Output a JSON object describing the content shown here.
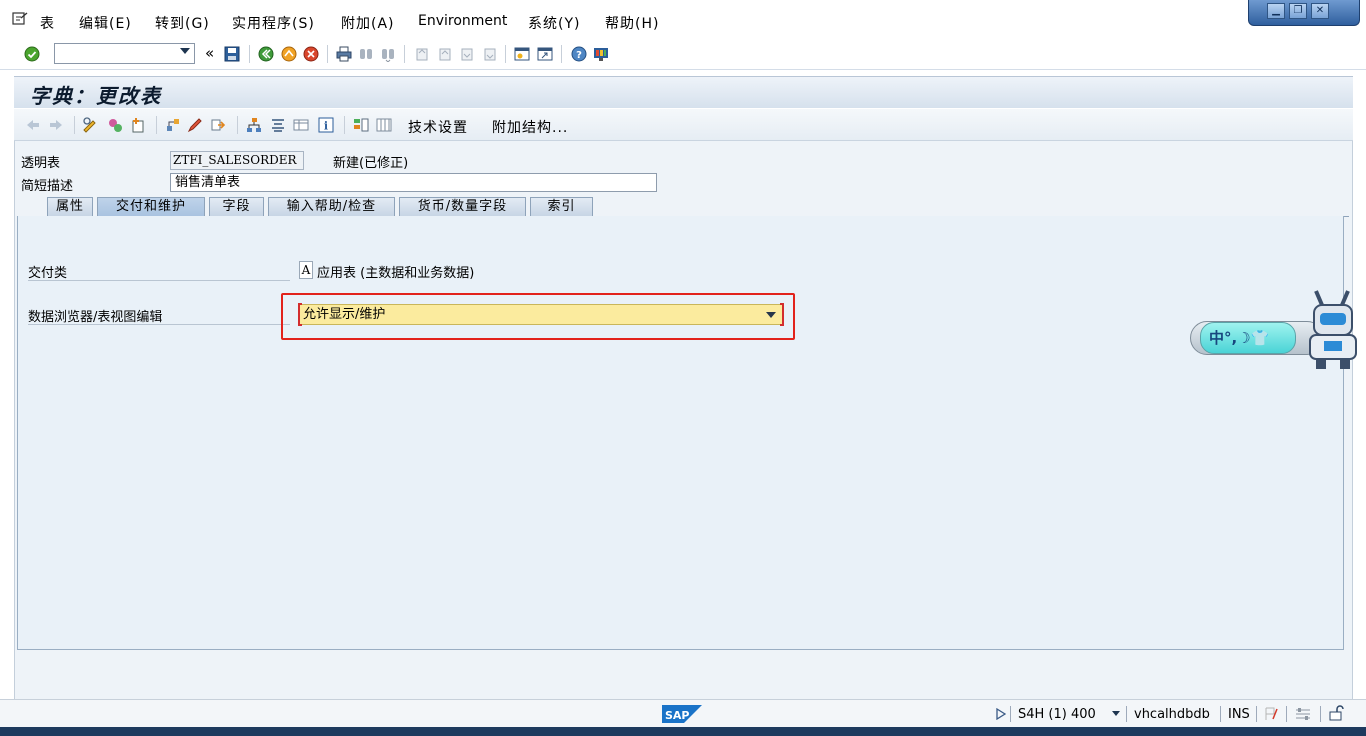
{
  "menu": {
    "items": [
      "表",
      "编辑(E)",
      "转到(G)",
      "实用程序(S)",
      "附加(A)",
      "Environment",
      "系统(Y)",
      "帮助(H)"
    ]
  },
  "window_controls": {
    "minimize": "▁",
    "restore": "❐",
    "close": "✕"
  },
  "toolbar": {
    "command_value": "",
    "back_glyph": "«"
  },
  "title": "字典：更改表",
  "app_toolbar": {
    "tech_settings": "技术设置",
    "append_structure": "附加结构..."
  },
  "header": {
    "table_type_label": "透明表",
    "table_name": "ZTFI_SALESORDER",
    "status": "新建(已修正)",
    "short_desc_label": "简短描述",
    "short_desc_value": "销售清单表"
  },
  "tabs": [
    {
      "label": "属性",
      "active": false
    },
    {
      "label": "交付和维护",
      "active": true
    },
    {
      "label": "字段",
      "active": false
    },
    {
      "label": "输入帮助/检查",
      "active": false
    },
    {
      "label": "货币/数量字段",
      "active": false
    },
    {
      "label": "索引",
      "active": false
    }
  ],
  "delivery": {
    "class_label": "交付类",
    "class_value": "A",
    "class_text": "应用表 (主数据和业务数据)",
    "browser_label": "数据浏览器/表视图编辑",
    "browser_value": "允许显示/维护"
  },
  "ime": {
    "text": "中°,☽👕"
  },
  "status_bar": {
    "system": "S4H (1) 400",
    "host": "vhcalhdbdb",
    "mode": "INS"
  },
  "colors": {
    "highlight": "#e2221b",
    "required_field_bg": "#fbeb9e",
    "panel_bg": "#e9f1f8"
  }
}
